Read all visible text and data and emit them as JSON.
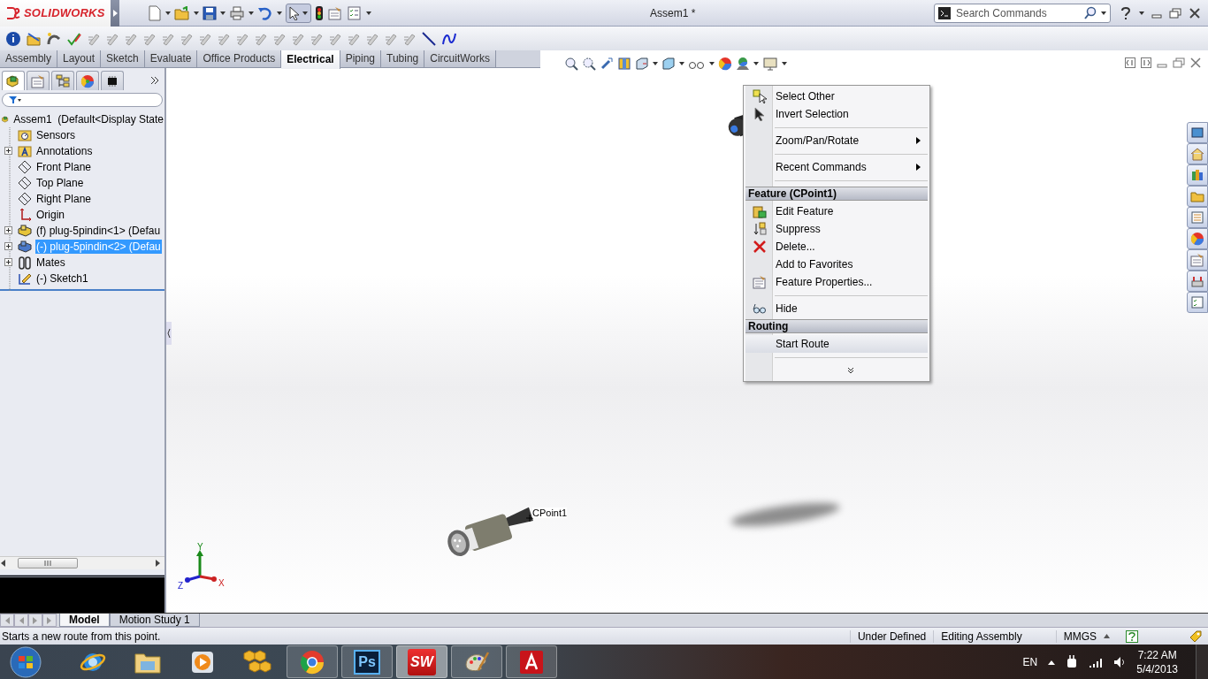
{
  "app": {
    "logo": "SOLIDWORKS"
  },
  "window": {
    "title": "Assem1 *"
  },
  "search": {
    "placeholder": "Search Commands"
  },
  "command_tabs": [
    {
      "label": "Assembly",
      "selected": false
    },
    {
      "label": "Layout",
      "selected": false
    },
    {
      "label": "Sketch",
      "selected": false
    },
    {
      "label": "Evaluate",
      "selected": false
    },
    {
      "label": "Office Products",
      "selected": false
    },
    {
      "label": "Electrical",
      "selected": true
    },
    {
      "label": "Piping",
      "selected": false
    },
    {
      "label": "Tubing",
      "selected": false
    },
    {
      "label": "CircuitWorks",
      "selected": false
    }
  ],
  "panel_tabs": [
    {
      "kind": "feature-manager",
      "selected": true
    },
    {
      "kind": "property-manager",
      "selected": false
    },
    {
      "kind": "configuration-manager",
      "selected": false
    },
    {
      "kind": "appearance",
      "selected": false
    },
    {
      "kind": "circuitworks",
      "selected": false
    }
  ],
  "feature_tree": {
    "items": [
      {
        "label": "Assem1  (Default<Display State",
        "kind": "assembly",
        "selected": false,
        "children": [
          {
            "label": "Sensors",
            "kind": "sensors",
            "selected": false,
            "collapsed": false
          },
          {
            "label": "Annotations",
            "kind": "annotations",
            "selected": false,
            "collapsed": true
          },
          {
            "label": "Front Plane",
            "kind": "plane",
            "selected": false,
            "collapsed": false
          },
          {
            "label": "Top Plane",
            "kind": "plane",
            "selected": false,
            "collapsed": false
          },
          {
            "label": "Right Plane",
            "kind": "plane",
            "selected": false,
            "collapsed": false
          },
          {
            "label": "Origin",
            "kind": "origin",
            "selected": false,
            "collapsed": false
          },
          {
            "label": "(f) plug-5pindin<1> (Defau",
            "kind": "part",
            "selected": false,
            "collapsed": true
          },
          {
            "label": "(-) plug-5pindin<2> (Defau",
            "kind": "part",
            "selected": true,
            "collapsed": true
          },
          {
            "label": "Mates",
            "kind": "mates",
            "selected": false,
            "collapsed": true
          },
          {
            "label": "(-) Sketch1",
            "kind": "sketch",
            "selected": false,
            "collapsed": false
          }
        ]
      }
    ]
  },
  "context_menu": {
    "items": [
      {
        "kind": "command",
        "label": "Select Other",
        "submenu": false,
        "selected": false
      },
      {
        "kind": "command",
        "label": "Invert Selection",
        "submenu": false,
        "selected": false
      },
      {
        "kind": "separator"
      },
      {
        "kind": "command",
        "label": "Zoom/Pan/Rotate",
        "submenu": true,
        "selected": false
      },
      {
        "kind": "separator"
      },
      {
        "kind": "command",
        "label": "Recent Commands",
        "submenu": true,
        "selected": false
      },
      {
        "kind": "separator"
      },
      {
        "kind": "header",
        "label": "Feature (CPoint1)"
      },
      {
        "kind": "command",
        "label": "Edit Feature",
        "submenu": false,
        "selected": false
      },
      {
        "kind": "command",
        "label": "Suppress",
        "submenu": false,
        "selected": false
      },
      {
        "kind": "command",
        "label": "Delete...",
        "submenu": false,
        "selected": false
      },
      {
        "kind": "command",
        "label": "Add to Favorites",
        "submenu": false,
        "selected": false
      },
      {
        "kind": "command",
        "label": "Feature Properties...",
        "submenu": false,
        "selected": false
      },
      {
        "kind": "separator"
      },
      {
        "kind": "command",
        "label": "Hide",
        "submenu": false,
        "selected": false
      },
      {
        "kind": "header",
        "label": "Routing"
      },
      {
        "kind": "command",
        "label": "Start Route",
        "submenu": false,
        "selected": true
      },
      {
        "kind": "separator"
      },
      {
        "kind": "more"
      }
    ]
  },
  "viewport": {
    "point_label": "CPoint1",
    "triad": {
      "x": "X",
      "y": "Y",
      "z": "Z"
    }
  },
  "bottom_tabs": [
    {
      "label": "Model",
      "selected": true
    },
    {
      "label": "Motion Study 1",
      "selected": false
    }
  ],
  "status_bar": {
    "message": "Starts a new route from this point.",
    "fields": [
      "Under Defined",
      "Editing Assembly",
      "MMGS"
    ]
  },
  "taskbar": {
    "apps": [
      {
        "kind": "browser-e",
        "running": false,
        "active": false
      },
      {
        "kind": "file-explorer",
        "running": false,
        "active": false
      },
      {
        "kind": "media-player",
        "running": false,
        "active": false
      },
      {
        "kind": "puzzle",
        "running": false,
        "active": false
      },
      {
        "kind": "chrome",
        "running": true,
        "active": false
      },
      {
        "kind": "photoshop",
        "label": "Ps",
        "running": true,
        "active": false
      },
      {
        "kind": "solidworks",
        "label": "SW",
        "running": true,
        "active": true
      },
      {
        "kind": "paint",
        "running": true,
        "active": false
      },
      {
        "kind": "acrobat",
        "running": true,
        "active": false
      }
    ],
    "language": "EN",
    "time": "7:22 AM",
    "date": "5/4/2013"
  }
}
